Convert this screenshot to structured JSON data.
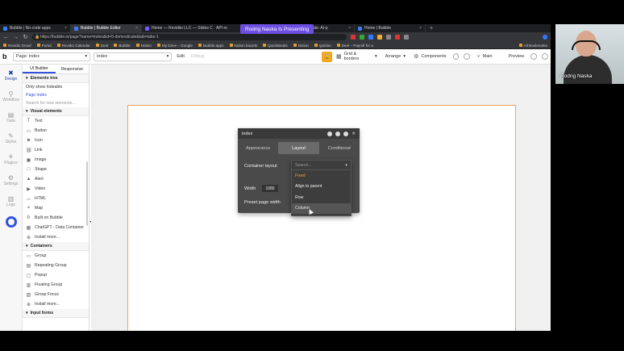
{
  "presenting_banner": "Rodrig Naska Is Presenting",
  "browser": {
    "tabs": [
      {
        "label": "Bubble | No-code apps",
        "active": false
      },
      {
        "label": "Bubble | Bubble Editor",
        "active": true
      },
      {
        "label": "Home — Revidiio LLC — Slides C",
        "active": false
      },
      {
        "label": "API re",
        "active": false
      },
      {
        "label": "nversity Template: AI-p",
        "active": false
      },
      {
        "label": "Home | Bubble",
        "active": false
      }
    ],
    "new_tab": "+",
    "url": "https://bubble.io/page?name=index&id=5-domesticate&tab=tabs-1",
    "bookmarks": [
      "Revidio Gmail",
      "Portal",
      "Revidio Calendar",
      "Dext",
      "Bubble",
      "Notion",
      "My Drive – Google",
      "Bubble apps",
      "Notion boards",
      "QuickBooks",
      "Notion",
      "Ignition",
      "Deel – Payroll for a",
      "All Bookmarks"
    ]
  },
  "toolbar": {
    "logo": "b",
    "page_label": "Page: index",
    "page_selector": "index",
    "edit_label": "Edit",
    "debug_label": "Debug",
    "grid_label": "Grid & borders",
    "arrange_label": "Arrange",
    "components_label": "Components",
    "branch_label": "Main",
    "preview_label": "Preview"
  },
  "rail": {
    "items": [
      {
        "label": "Design",
        "glyph": "✖",
        "active": true
      },
      {
        "label": "Workflow",
        "glyph": "⚲",
        "active": false
      },
      {
        "label": "Data",
        "glyph": "▤",
        "active": false
      },
      {
        "label": "Styles",
        "glyph": "✎",
        "active": false
      },
      {
        "label": "Plugins",
        "glyph": "⚘",
        "active": false
      },
      {
        "label": "Settings",
        "glyph": "⚙",
        "active": false
      },
      {
        "label": "Logs",
        "glyph": "▥",
        "active": false
      }
    ]
  },
  "panel": {
    "tab_ui_builder": "UI Builder",
    "tab_responsive": "Responsive",
    "elements_tree": "Elements tree",
    "only_hideable": "Only show hideable",
    "page_index": "Page index",
    "search_placeholder": "Search for new elements...",
    "visual_header": "Visual elements",
    "visual_items": [
      {
        "label": "Text",
        "icon": "T"
      },
      {
        "label": "Button",
        "icon": "▭"
      },
      {
        "label": "Icon",
        "icon": "⚑"
      },
      {
        "label": "Link",
        "icon": "⛓"
      },
      {
        "label": "Image",
        "icon": "▣"
      },
      {
        "label": "Shape",
        "icon": "□"
      },
      {
        "label": "Alert",
        "icon": "▲"
      },
      {
        "label": "Video",
        "icon": "▶"
      },
      {
        "label": "HTML",
        "icon": "</>"
      },
      {
        "label": "Map",
        "icon": "⌖"
      },
      {
        "label": "Built on Bubble",
        "icon": "b"
      },
      {
        "label": "ChatGPT - Data Container",
        "icon": "▦"
      },
      {
        "label": "Install more...",
        "icon": "⊕"
      }
    ],
    "containers_header": "Containers",
    "container_items": [
      {
        "label": "Group",
        "icon": "▭"
      },
      {
        "label": "Repeating Group",
        "icon": "▤"
      },
      {
        "label": "Popup",
        "icon": "▢"
      },
      {
        "label": "Floating Group",
        "icon": "▥"
      },
      {
        "label": "Group Focus",
        "icon": "▧"
      },
      {
        "label": "Install more...",
        "icon": "⊕"
      }
    ],
    "inputs_header": "Input forms"
  },
  "property_editor": {
    "title": "index",
    "tabs": [
      "Appearance",
      "Layout",
      "Conditional"
    ],
    "active_tab": "Layout",
    "container_layout_label": "Container layout",
    "width_label": "Width",
    "width_value": "1080",
    "preset_label": "Preset page width"
  },
  "dropdown": {
    "search_placeholder": "Search...",
    "options": [
      "Fixed",
      "Align to parent",
      "Row",
      "Column"
    ],
    "selected": "Fixed",
    "hovered": "Column"
  },
  "webcam": {
    "name": "Rodrig Naska"
  }
}
